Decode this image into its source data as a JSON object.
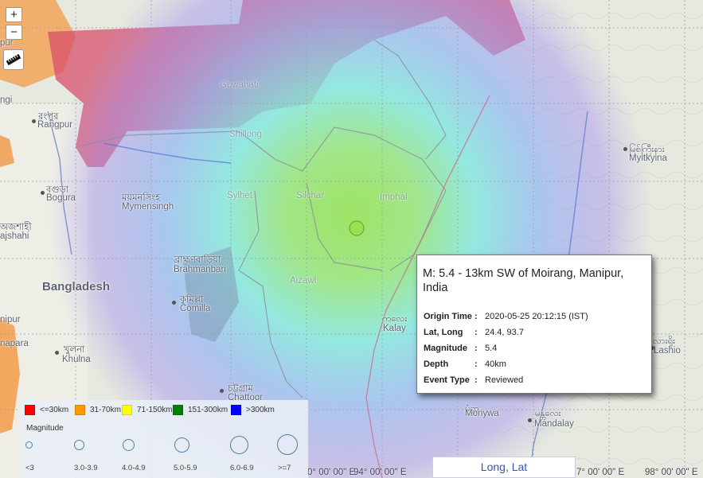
{
  "zoom": {
    "in": "+",
    "out": "−"
  },
  "places": [
    {
      "key": "guwahati",
      "text": "Guwahati",
      "faint": true
    },
    {
      "key": "rangpur_native",
      "text": "রংপুর",
      "native": true
    },
    {
      "key": "rangpur",
      "text": "Rangpur"
    },
    {
      "key": "shillong",
      "text": "Shillong",
      "faint": true
    },
    {
      "key": "myitkyina_native",
      "text": "မြစ်ကြီးနား",
      "native": true
    },
    {
      "key": "myitkyina",
      "text": "Myitkyina"
    },
    {
      "key": "bogura_native",
      "text": "বগুড়া",
      "native": true
    },
    {
      "key": "bogura",
      "text": "Bogura"
    },
    {
      "key": "mymensingh_native",
      "text": "ময়মনসিংহ",
      "native": true
    },
    {
      "key": "mymensingh",
      "text": "Mymensingh"
    },
    {
      "key": "sylhet",
      "text": "Sylhet",
      "faint": true
    },
    {
      "key": "silchar",
      "text": "Silchar",
      "faint": true
    },
    {
      "key": "imphal",
      "text": "Imphal",
      "faint": true
    },
    {
      "key": "rajshahi_native",
      "text": "অজশাহী",
      "native": true
    },
    {
      "key": "rajshahi",
      "text": "ajshahi"
    },
    {
      "key": "brahmanbaria_native",
      "text": "ব্রাহ্মণবাড়িয়া",
      "native": true
    },
    {
      "key": "brahmanbaria",
      "text": "Brahmanbari"
    },
    {
      "key": "bangladesh",
      "text": "Bangladesh",
      "country": true
    },
    {
      "key": "comilla_native",
      "text": "কুমিল্লা",
      "native": true
    },
    {
      "key": "comilla",
      "text": "Comilla"
    },
    {
      "key": "aizawl",
      "text": "Aizawl",
      "faint": true
    },
    {
      "key": "kalay_native",
      "text": "ကလေး",
      "native": true
    },
    {
      "key": "kalay",
      "text": "Kalay"
    },
    {
      "key": "lashio_native",
      "text": "လားရှိုး",
      "native": true
    },
    {
      "key": "lashio",
      "text": "Lashio"
    },
    {
      "key": "khulna_native",
      "text": "খুলনা",
      "native": true
    },
    {
      "key": "khulna",
      "text": "Khulna"
    },
    {
      "key": "chattogram_native",
      "text": "চট্টগ্রাম",
      "native": true
    },
    {
      "key": "chattogram",
      "text": "Chattogr"
    },
    {
      "key": "monywa_native",
      "text": "မုံရွာ",
      "native": true
    },
    {
      "key": "monywa",
      "text": "Monywa"
    },
    {
      "key": "mandalay_native",
      "text": "မန္တလေး",
      "native": true
    },
    {
      "key": "mandalay",
      "text": "Mandalay"
    },
    {
      "key": "edge_pur",
      "text": "pur"
    },
    {
      "key": "edge_ngi",
      "text": "ngi"
    },
    {
      "key": "edge_nipur",
      "text": "nipur"
    },
    {
      "key": "edge_napara",
      "text": "napara"
    }
  ],
  "coords": [
    {
      "key": "c1",
      "text": "0° 00' 00\" E"
    },
    {
      "key": "c2",
      "text": "94° 00' 00\" E"
    },
    {
      "key": "c3",
      "text": "7° 00' 00\" E"
    },
    {
      "key": "c4",
      "text": "98° 00' 00\" E"
    }
  ],
  "legend": {
    "depth": [
      {
        "label": "<=30km",
        "color": "#ff0000"
      },
      {
        "label": "31-70km",
        "color": "#ff9900"
      },
      {
        "label": "71-150km",
        "color": "#ffff00"
      },
      {
        "label": "151-300km",
        "color": "#008000"
      },
      {
        "label": ">300km",
        "color": "#0000ff"
      }
    ],
    "magnitude_title": "Magnitude",
    "magnitude": [
      {
        "label": "<3"
      },
      {
        "label": "3.0-3.9"
      },
      {
        "label": "4.0-4.9"
      },
      {
        "label": "5.0-5.9"
      },
      {
        "label": "6.0-6.9"
      },
      {
        "label": ">=7"
      }
    ]
  },
  "popup": {
    "title": "M: 5.4 - 13km SW of Moirang, Manipur, India",
    "rows": [
      {
        "key": "Origin Time",
        "value": "2020-05-25 20:12:15 (IST)"
      },
      {
        "key": "Lat, Long",
        "value": "24.4, 93.7"
      },
      {
        "key": "Magnitude",
        "value": "5.4"
      },
      {
        "key": "Depth",
        "value": "40km"
      },
      {
        "key": "Event Type",
        "value": "Reviewed"
      }
    ]
  },
  "longlat_button": "Long, Lat",
  "event_marker": {
    "magnitude": 5.4,
    "depth_km": 40,
    "color": "#9be050"
  }
}
